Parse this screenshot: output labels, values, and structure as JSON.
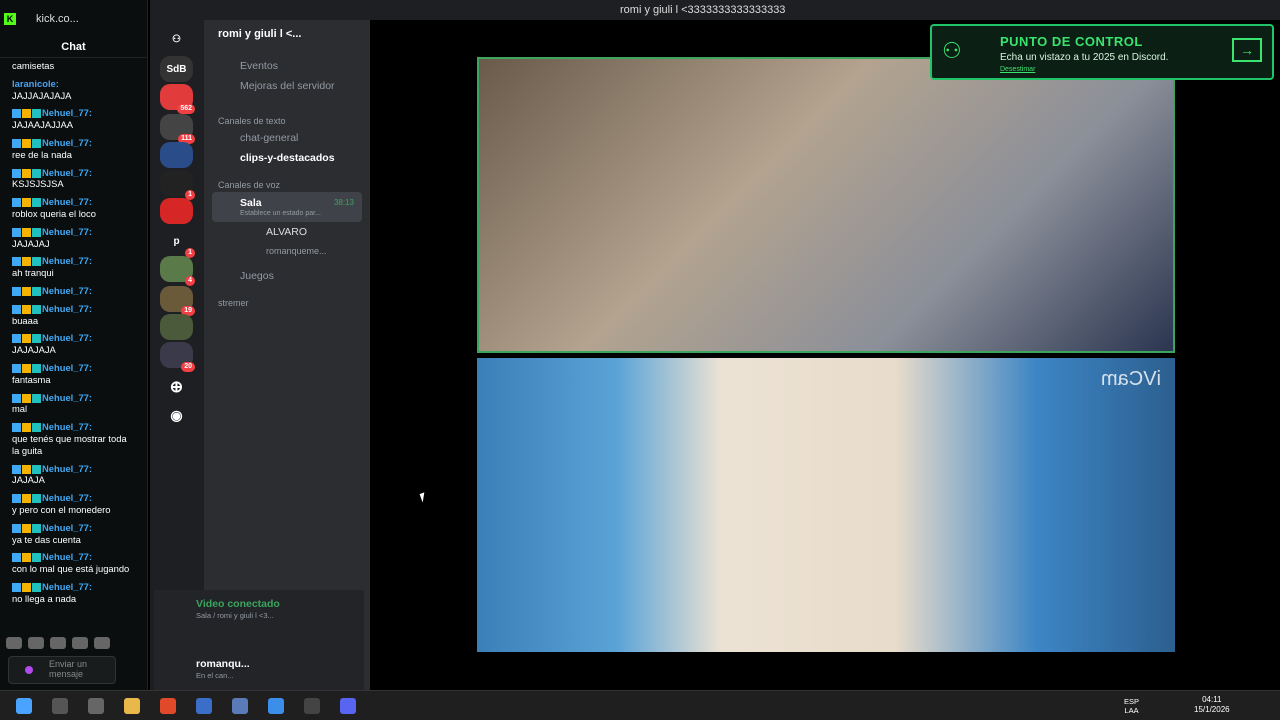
{
  "kick": {
    "tab": "kick.co...",
    "chat_header": "Chat",
    "messages": [
      {
        "user": "",
        "text": "camisetas"
      },
      {
        "user": "laranicole:",
        "text": "JAJJAJAJAJA",
        "plain": true
      },
      {
        "user": "Nehuel_77:",
        "text": "JAJAAJAJJAA"
      },
      {
        "user": "Nehuel_77:",
        "text": "ree de la nada"
      },
      {
        "user": "Nehuel_77:",
        "text": "KSJSJSJSA"
      },
      {
        "user": "Nehuel_77:",
        "text": "roblox queria el loco"
      },
      {
        "user": "Nehuel_77:",
        "text": "JAJAJAJ"
      },
      {
        "user": "Nehuel_77:",
        "text": "ah tranqui"
      },
      {
        "user": "Nehuel_77:",
        "text": ""
      },
      {
        "user": "Nehuel_77:",
        "text": "buaaa"
      },
      {
        "user": "Nehuel_77:",
        "text": "JAJAJAJA"
      },
      {
        "user": "Nehuel_77:",
        "text": "fantasma"
      },
      {
        "user": "Nehuel_77:",
        "text": "mal"
      },
      {
        "user": "Nehuel_77:",
        "text": "que tenés que mostrar toda la guita"
      },
      {
        "user": "Nehuel_77:",
        "text": "JAJAJA"
      },
      {
        "user": "Nehuel_77:",
        "text": "y pero con el monedero"
      },
      {
        "user": "Nehuel_77:",
        "text": "ya te das cuenta"
      },
      {
        "user": "Nehuel_77:",
        "text": "con lo mal que está jugando"
      },
      {
        "user": "Nehuel_77:",
        "text": "no llega a nada"
      }
    ],
    "input_placeholder": "Enviar un mensaje"
  },
  "discord": {
    "title": "romi y giuli l <3333333333333333",
    "server": "romi y giuli l <...",
    "guild_sdb": "SdB",
    "guild_p": "p",
    "badges": [
      "562",
      "111",
      "1",
      "1",
      "4",
      "19",
      "20"
    ],
    "events": "Eventos",
    "boosts": "Mejoras del servidor",
    "text_cat": "Canales de texto",
    "ch1": "chat-general",
    "ch2": "clips-y-destacados",
    "voice_cat": "Canales de voz",
    "sala": "Sala",
    "sala_time": "38:13",
    "sala_status": "Establece un estado par...",
    "u1": "ALVARO",
    "u2": "romanqueme...",
    "juegos": "Juegos",
    "stremer": "stremer",
    "vc_title": "Video conectado",
    "vc_sub": "Sala / romi y giuli l <3...",
    "me": "romanqu...",
    "me_status": "En el can..."
  },
  "banner": {
    "heading": "PUNTO DE CONTROL",
    "sub": "Echa un vistazo a tu 2025 en Discord.",
    "dismiss": "Desestimar"
  },
  "video": {
    "watermark": "iVCam"
  },
  "taskbar": {
    "lang1": "ESP",
    "lang2": "LAA",
    "time": "04:11",
    "date": "15/1/2026"
  }
}
